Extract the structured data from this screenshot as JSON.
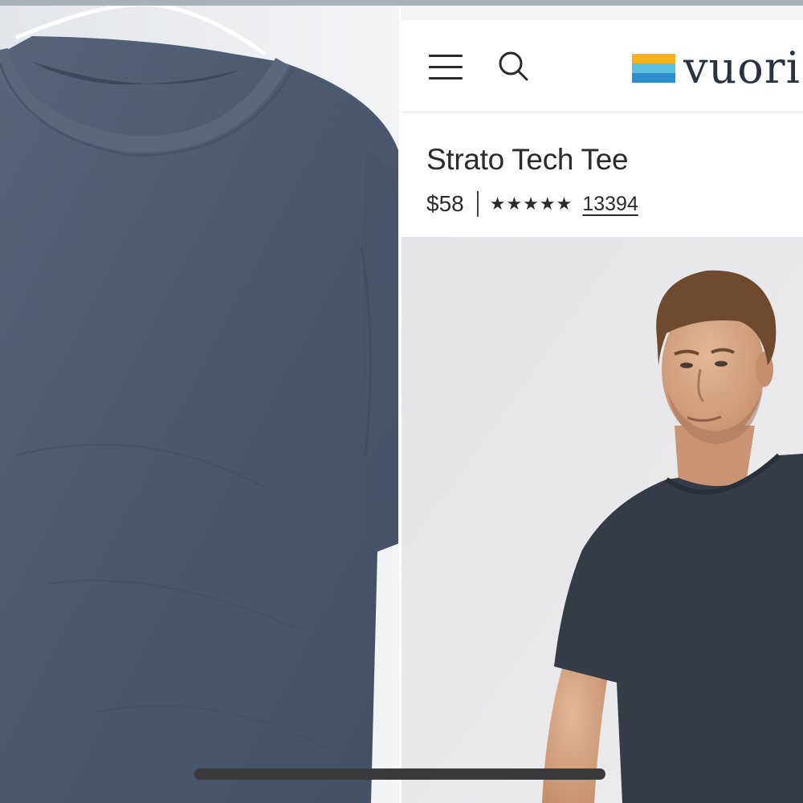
{
  "nav": {
    "menu_icon": "hamburger-menu-icon",
    "search_icon": "search-icon",
    "logo_text": "vuori",
    "logo_colors": [
      "#f6b21b",
      "#5fbfe0",
      "#2e8fd0"
    ]
  },
  "product": {
    "title": "Strato Tech Tee",
    "price": "$58",
    "rating_stars": "★★★★★",
    "rating_value": 5,
    "review_count": "13394"
  },
  "photos": {
    "left_shirt_color": "#4b586d",
    "model_shirt_color": "#353c47"
  },
  "colors": {
    "text": "#2b2b2b",
    "scroll_indicator": "#3a3a3c"
  }
}
